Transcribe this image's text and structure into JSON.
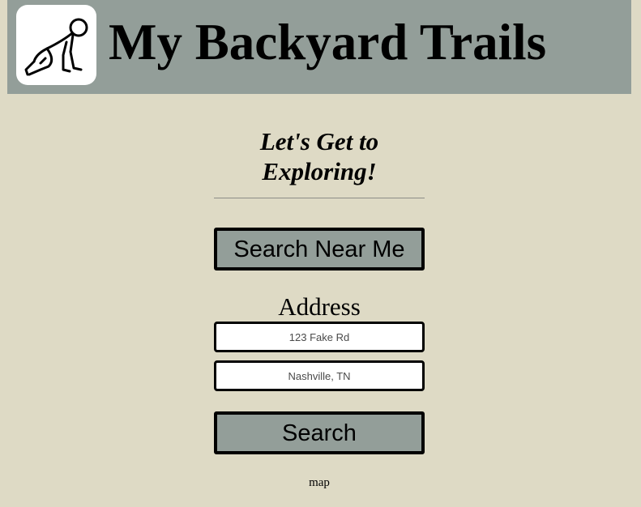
{
  "header": {
    "title": "My Backyard Trails",
    "logo_icon": "crawling-baby-icon",
    "background": "#939e99"
  },
  "hero": {
    "tagline_line1": "Let's Get to",
    "tagline_line2": "Exploring!"
  },
  "actions": {
    "near_me_label": "Search Near Me",
    "search_label": "Search"
  },
  "address": {
    "label": "Address",
    "street_placeholder": "123 Fake Rd",
    "city_placeholder": "Nashville, TN"
  },
  "map": {
    "label": "map"
  },
  "colors": {
    "page_background": "#dedac5",
    "button_background": "#939e99"
  }
}
